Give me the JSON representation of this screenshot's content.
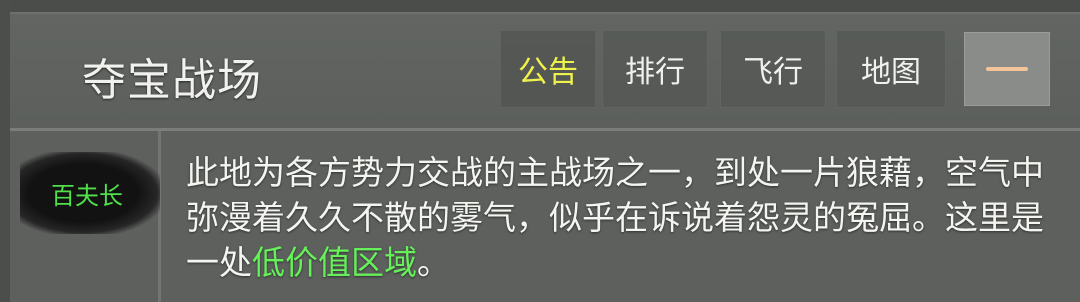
{
  "header": {
    "title": "夺宝战场",
    "tabs": [
      {
        "label": "公告",
        "active": true
      },
      {
        "label": "排行",
        "active": false
      },
      {
        "label": "飞行",
        "active": false
      },
      {
        "label": "地图",
        "active": false
      }
    ],
    "collapse_icon": "minus-icon"
  },
  "rank": {
    "label": "百夫长",
    "color": "#4fe04a"
  },
  "description": {
    "text": "此地为各方势力交战的主战场之一，到处一片狼藉，空气中弥漫着久久不散的雾气，似乎在诉说着怨灵的冤屈。这里是一处",
    "highlight": "低价值区域",
    "suffix": "。",
    "highlight_color": "#66f05a"
  },
  "colors": {
    "active_tab": "#eef24a",
    "text": "#f4f4f0",
    "panel": "#5d605d"
  }
}
